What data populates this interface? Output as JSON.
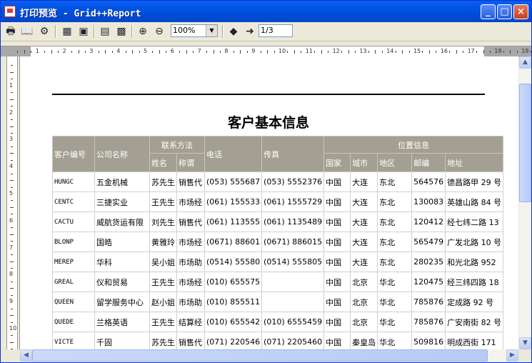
{
  "window": {
    "title": "打印预览 - Grid++Report",
    "minimize": "_",
    "maximize": "□",
    "close": "×"
  },
  "toolbar": {
    "zoom": "100%",
    "page": "1/3"
  },
  "report": {
    "title": "客户基本信息",
    "groups": {
      "contact": "联系方法",
      "location": "位置信息"
    },
    "columns": {
      "code": "客户编号",
      "company": "公司名称",
      "name": "姓名",
      "position": "称谓",
      "phone": "电话",
      "fax": "传真",
      "country": "国家",
      "city": "城市",
      "region": "地区",
      "zip": "邮编",
      "address": "地址"
    },
    "rows": [
      [
        "HUNGC",
        "五金机械",
        "苏先生",
        "销售代",
        "(053) 555687",
        "(053) 5552376",
        "中国",
        "大连",
        "东北",
        "564576",
        "德昌路甲 29 号"
      ],
      [
        "CENTC",
        "三捷实业",
        "王先生",
        "市场经",
        "(061) 155533",
        "(061) 1555729",
        "中国",
        "大连",
        "东北",
        "130083",
        "英雄山路 84 号"
      ],
      [
        "CACTU",
        "威航货运有限",
        "刘先生",
        "销售代",
        "(061) 113555",
        "(061) 1135489",
        "中国",
        "大连",
        "东北",
        "120412",
        "经七纬二路 13"
      ],
      [
        "BLONP",
        "国皓",
        "黄雅玲",
        "市场经",
        "(0671) 88601",
        "(0671) 886015",
        "中国",
        "大连",
        "东北",
        "565479",
        "广发北路 10 号"
      ],
      [
        "MEREP",
        "华科",
        "吴小姐",
        "市场助",
        "(0514) 55580",
        "(0514) 555805",
        "中国",
        "大连",
        "东北",
        "280235",
        "和光北路 952"
      ],
      [
        "GREAL",
        "仪和贸易",
        "王先生",
        "市场经",
        "(010) 655575",
        "",
        "中国",
        "北京",
        "华北",
        "120475",
        "经三纬四路 18"
      ],
      [
        "QUEEN",
        "留学服务中心",
        "赵小姐",
        "市场助",
        "(010) 855511",
        "",
        "中国",
        "北京",
        "华北",
        "785876",
        "定成路 92 号"
      ],
      [
        "QUEDE",
        "兰格英语",
        "王先生",
        "结算经",
        "(010) 655542",
        "(010) 6555459",
        "中国",
        "北京",
        "华北",
        "785876",
        "广安南街 82 号"
      ],
      [
        "VICTE",
        "千固",
        "苏先生",
        "销售代",
        "(071) 220546",
        "(071) 2205460",
        "中国",
        "秦皇岛",
        "华北",
        "509816",
        "明成西街 171"
      ]
    ]
  }
}
